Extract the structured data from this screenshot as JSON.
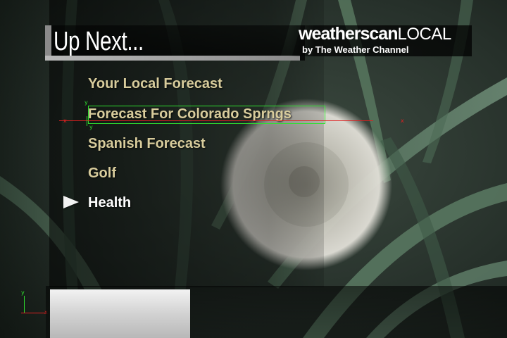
{
  "header": {
    "title": "Up Next...",
    "brand_bold": "weatherscan",
    "brand_light": "LOCAL",
    "brand_tagline": "by The Weather Channel"
  },
  "menu": {
    "items": [
      {
        "label": "Your Local Forecast",
        "active": false
      },
      {
        "label": "Forecast For Colorado Sprngs",
        "active": false
      },
      {
        "label": "Spanish Forecast",
        "active": false
      },
      {
        "label": "Golf",
        "active": false
      },
      {
        "label": "Health",
        "active": true
      }
    ]
  },
  "debug_overlay": {
    "x_label": "x",
    "y_label": "y",
    "selection_color": "#2fe02f",
    "baseline_color": "#e02020"
  },
  "colors": {
    "menu_text": "#d8cc9c",
    "menu_active_text": "#ffffff",
    "title_text": "#ffffff"
  },
  "icons": {
    "selector": "play-arrow-icon"
  }
}
